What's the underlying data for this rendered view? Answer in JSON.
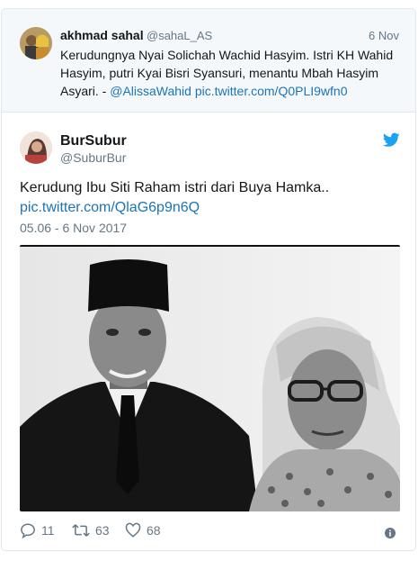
{
  "quoted_tweet": {
    "author_name": "akhmad sahal",
    "author_handle": "@sahaL_AS",
    "date": "6 Nov",
    "text_plain": "Kerudungnya Nyai Solichah Wachid Hasyim. Istri KH Wahid Hasyim, putri Kyai Bisri Syansuri, menantu Mbah Hasyim Asyari. -",
    "mention": "@AlissaWahid",
    "link": "pic.twitter.com/Q0PLI9wfn0"
  },
  "tweet": {
    "author_name": "BurSubur",
    "author_handle": "@SuburBur",
    "text": "Kerudung Ibu Siti Raham istri dari Buya Hamka..",
    "link": "pic.twitter.com/QlaG6p9n6Q",
    "timestamp": "05.06 - 6 Nov 2017"
  },
  "actions": {
    "replies": "11",
    "retweets": "63",
    "likes": "68"
  },
  "colors": {
    "link": "#1b74b6",
    "secondary_text": "#657786",
    "twitter_blue": "#1da1f2",
    "border": "#e1e8ed"
  },
  "icons": {
    "reply": "reply-icon",
    "retweet": "retweet-icon",
    "like": "heart-icon",
    "info": "info-icon",
    "brand": "twitter-bird-icon"
  }
}
